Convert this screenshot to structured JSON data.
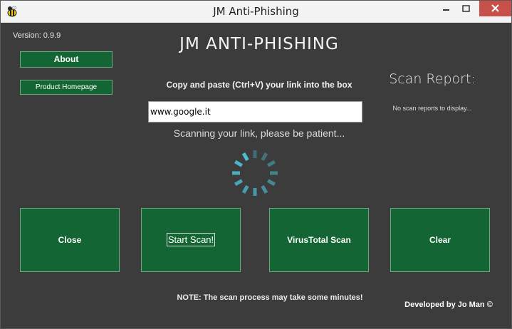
{
  "window": {
    "title": "JM Anti-Phishing"
  },
  "app": {
    "version": "Version: 0.9.9",
    "heading": "JM ANTI-PHISHING",
    "about_label": "About",
    "homepage_label": "Product Homepage",
    "instruction": "Copy and paste (Ctrl+V) your link into the box",
    "url_value": "www.google.it",
    "scanning_text": "Scanning your link, please be patient...",
    "scan_report_title": "Scan Report:",
    "scan_report_text": "No scan reports to display...",
    "buttons": {
      "close": "Close",
      "start_scan": "Start Scan!",
      "virustotal": "VirusTotal Scan",
      "clear": "Clear"
    },
    "note": "NOTE: The scan process may take some minutes!",
    "developer": "Developed by Jo Man ©"
  },
  "colors": {
    "background": "#3c3c3c",
    "button_green": "#136633",
    "close_red": "#c7504b",
    "spinner": "#4fc3d9"
  }
}
